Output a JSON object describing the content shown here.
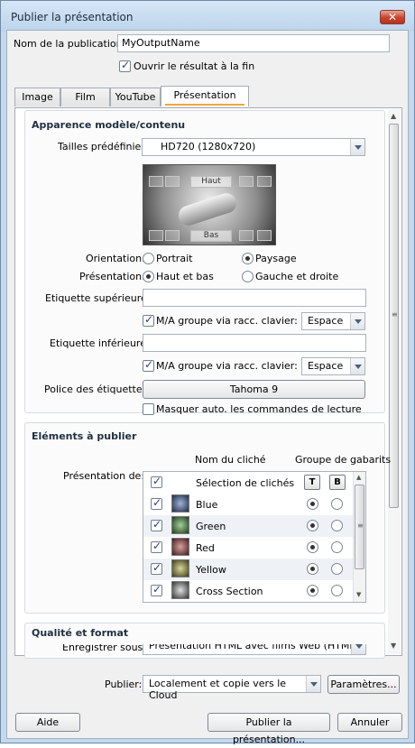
{
  "window": {
    "title": "Publier la présentation",
    "close_glyph": "✕"
  },
  "publication": {
    "name_label": "Nom de la publication:",
    "name_value": "MyOutputName",
    "open_result_label": "Ouvrir le résultat à la fin"
  },
  "tabs": [
    {
      "label": "Image"
    },
    {
      "label": "Film"
    },
    {
      "label": "YouTube"
    },
    {
      "label": "Présentation Web"
    }
  ],
  "appearance": {
    "section_title": "Apparence modèle/contenu",
    "preset_label": "Tailles prédéfinies:",
    "preset_value": "HD720 (1280x720)",
    "preview_top": "Haut",
    "preview_bottom": "Bas",
    "orientation_label": "Orientation:",
    "orientation_portrait": "Portrait",
    "orientation_landscape": "Paysage",
    "presentation_label": "Présentation:",
    "presentation_topbottom": "Haut et bas",
    "presentation_leftright": "Gauche et droite",
    "top_label_label": "Etiquette supérieure:",
    "top_label_value": "",
    "top_toggle_label": "M/A groupe via racc. clavier:",
    "top_key_value": "Espace",
    "bottom_label_label": "Etiquette inférieure:",
    "bottom_label_value": "",
    "bottom_toggle_label": "M/A groupe via racc. clavier:",
    "bottom_key_value": "Espace",
    "font_label": "Police des étiquettes:",
    "font_value": "Tahoma 9",
    "autohide_label": "Masquer auto. les commandes de lecture"
  },
  "elements": {
    "section_title": "Eléments à publier",
    "col_name": "Nom du cliché",
    "col_group": "Groupe de gabarits",
    "presentation_label": "Présentation de:",
    "select_all_label": "Sélection de clichés",
    "btn_t": "T",
    "btn_b": "B",
    "items": [
      {
        "name": "Blue",
        "checked": true
      },
      {
        "name": "Green",
        "checked": true
      },
      {
        "name": "Red",
        "checked": true
      },
      {
        "name": "Yellow",
        "checked": true
      },
      {
        "name": "Cross Section",
        "checked": true
      }
    ]
  },
  "quality": {
    "section_title": "Qualité et format",
    "save_label_partial": "Enregistrer sous:",
    "save_value_partial": "Présentation HTML avec films Web (HTML)"
  },
  "footer": {
    "publish_label": "Publier:",
    "publish_value": "Localement et copie vers le Cloud",
    "params_button": "Paramètres...",
    "help_button": "Aide",
    "publish_button": "Publier la présentation...",
    "cancel_button": "Annuler"
  }
}
